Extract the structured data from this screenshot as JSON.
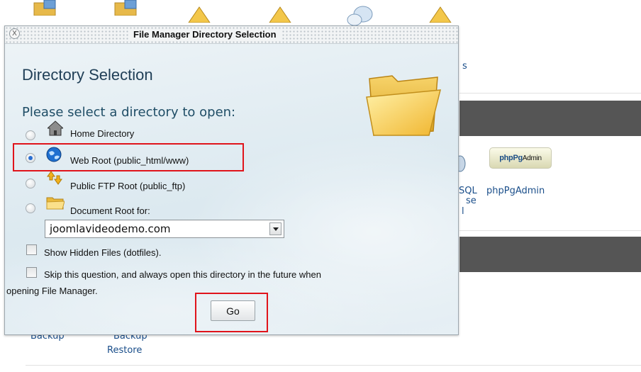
{
  "background": {
    "label_fragment_s": "s",
    "label_fragment_sql": "SQL",
    "label_fragment_se": "se",
    "label_fragment_l": "l",
    "phppgadmin_logo_pg": "phpPg",
    "phppgadmin_logo_admin": "Admin",
    "phppgadmin_label": "phpPgAdmin",
    "backup_label_partial": "Backup",
    "backup_restore_label_partial": "Backup",
    "backup_restore_label": "Restore"
  },
  "dialog": {
    "close_label": "X",
    "title": "File Manager Directory Selection",
    "heading": "Directory Selection",
    "prompt": "Please select a directory to open:",
    "options": [
      {
        "label": "Home Directory",
        "icon": "home-icon",
        "checked": false
      },
      {
        "label": "Web Root (public_html/www)",
        "icon": "globe-icon",
        "checked": true
      },
      {
        "label": "Public FTP Root (public_ftp)",
        "icon": "ftp-arrows-icon",
        "checked": false
      },
      {
        "label": "Document Root for:",
        "icon": "folder-icon",
        "checked": false
      }
    ],
    "document_root_select": {
      "selected": "joomlavideodemo.com"
    },
    "show_hidden_label": "Show Hidden Files (dotfiles).",
    "skip_question_label_line1": "Skip this question, and always open this directory in the future when",
    "skip_question_label_line2": "opening File Manager.",
    "go_label": "Go"
  },
  "colors": {
    "highlight": "#e0141b",
    "heading": "#1f3e56",
    "link_blue": "#1a4e8a",
    "band_gray": "#555555"
  }
}
